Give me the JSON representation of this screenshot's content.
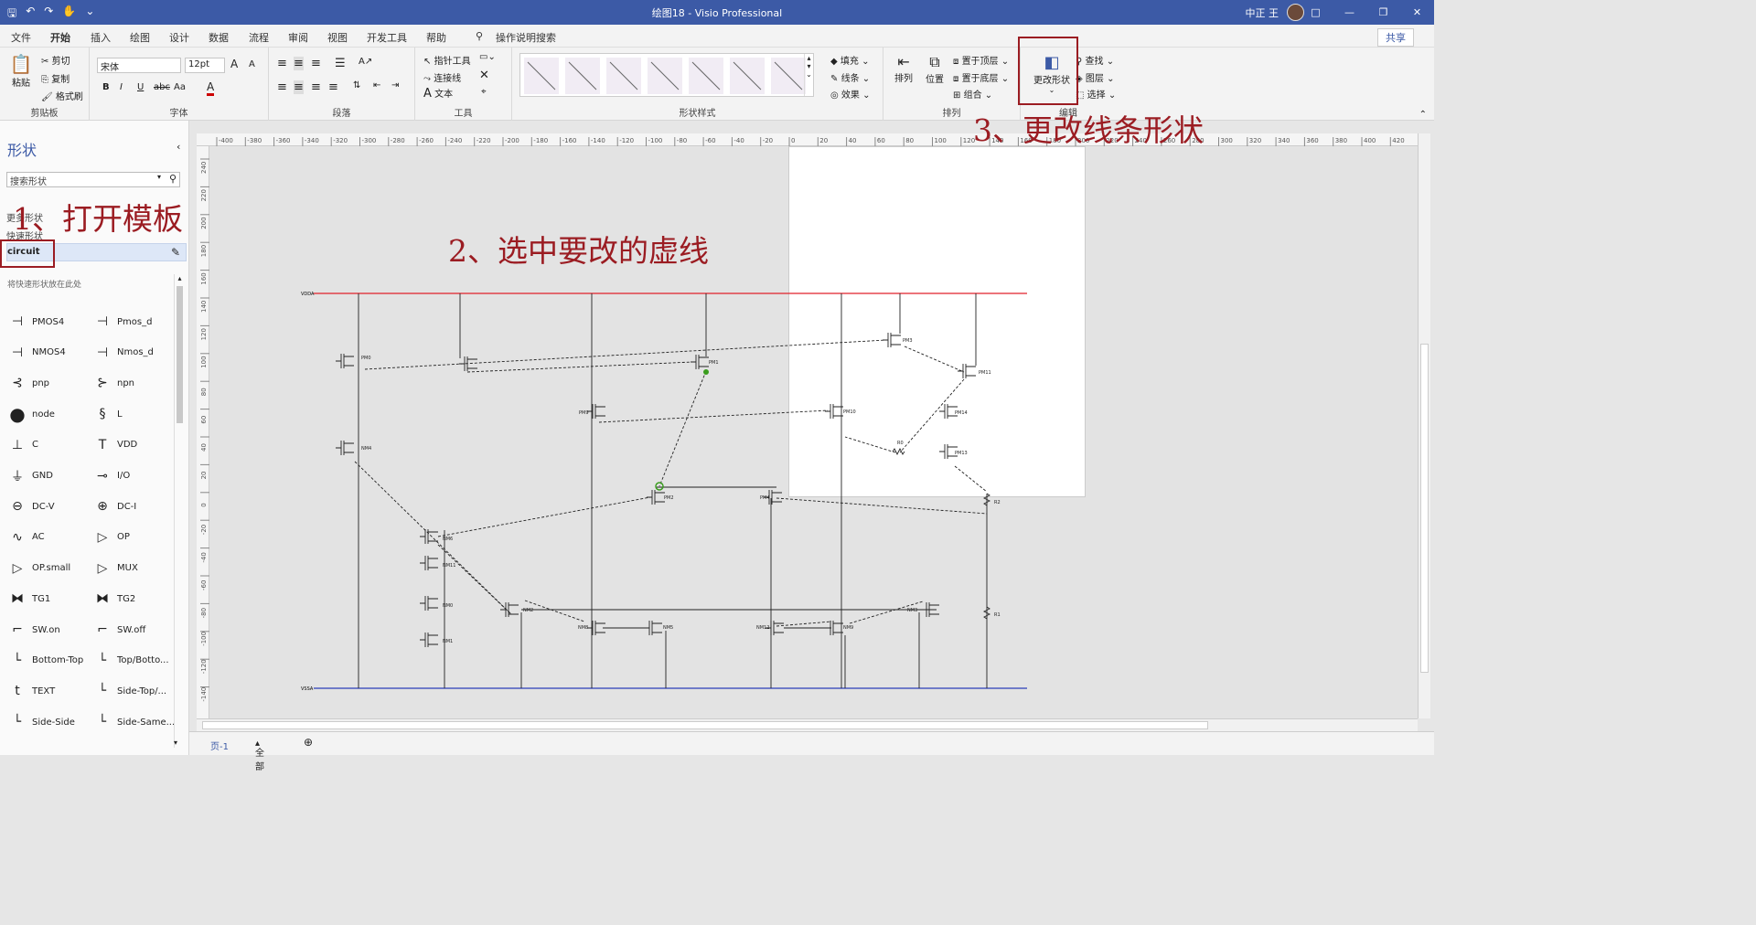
{
  "titlebar": {
    "title": "绘图18  -  Visio Professional",
    "user": "中正 王",
    "icons": [
      "save-icon",
      "undo-icon",
      "redo-icon",
      "touch-mode-icon",
      "customize-icon"
    ],
    "window_controls": [
      "□",
      "—",
      "❐",
      "✕"
    ]
  },
  "menubar": {
    "tabs": [
      "文件",
      "开始",
      "插入",
      "绘图",
      "设计",
      "数据",
      "流程",
      "审阅",
      "视图",
      "开发工具",
      "帮助"
    ],
    "active_tab": "开始",
    "tell_me": "操作说明搜索",
    "share": "共享"
  },
  "ribbon": {
    "clipboard": {
      "paste": "粘贴",
      "cut": "剪切",
      "copy": "复制",
      "format_painter": "格式刷",
      "label": "剪贴板"
    },
    "font": {
      "name": "宋体",
      "size": "12pt",
      "label": "字体",
      "bold": "B",
      "italic": "I",
      "underline": "U",
      "strike": "abc",
      "case": "Aa",
      "grow": "A",
      "shrink": "A"
    },
    "paragraph": {
      "label": "段落"
    },
    "tools": {
      "pointer": "指针工具",
      "connector": "连接线",
      "text": "文本",
      "label": "工具"
    },
    "shape_styles": {
      "label": "形状样式",
      "fill": "填充",
      "line": "线条",
      "effects": "效果"
    },
    "arrange": {
      "arrange": "排列",
      "position": "位置",
      "bring_front": "置于顶层",
      "send_back": "置于底层",
      "group": "组合",
      "label": "排列"
    },
    "edit": {
      "change_shape": "更改形状",
      "find": "查找",
      "layers": "图层",
      "select": "选择",
      "label": "编辑"
    }
  },
  "left_panel": {
    "title": "形状",
    "search_placeholder": "搜索形状",
    "more_shapes": "更多形状",
    "quick_shapes": "快速形状",
    "stencil": "circuit",
    "hint": "将快速形状放在此处",
    "shapes": [
      {
        "label": "PMOS4",
        "icon": "pmos-icon"
      },
      {
        "label": "Pmos_d",
        "icon": "pmos-icon"
      },
      {
        "label": "NMOS4",
        "icon": "nmos-icon"
      },
      {
        "label": "Nmos_d",
        "icon": "nmos-icon"
      },
      {
        "label": "pnp",
        "icon": "pnp-icon"
      },
      {
        "label": "npn",
        "icon": "npn-icon"
      },
      {
        "label": "node",
        "icon": "node-icon"
      },
      {
        "label": "L",
        "icon": "inductor-icon"
      },
      {
        "label": "C",
        "icon": "capacitor-icon"
      },
      {
        "label": "VDD",
        "icon": "vdd-icon"
      },
      {
        "label": "GND",
        "icon": "ground-icon"
      },
      {
        "label": "I/O",
        "icon": "io-icon"
      },
      {
        "label": "DC-V",
        "icon": "dcv-icon"
      },
      {
        "label": "DC-I",
        "icon": "dci-icon"
      },
      {
        "label": "AC",
        "icon": "ac-icon"
      },
      {
        "label": "OP",
        "icon": "opamp-icon"
      },
      {
        "label": "OP.small",
        "icon": "opamp-icon"
      },
      {
        "label": "MUX",
        "icon": "mux-icon"
      },
      {
        "label": "TG1",
        "icon": "tg-icon"
      },
      {
        "label": "TG2",
        "icon": "tg-icon"
      },
      {
        "label": "SW.on",
        "icon": "switch-icon"
      },
      {
        "label": "SW.off",
        "icon": "switch-icon"
      },
      {
        "label": "Bottom-Top",
        "icon": "connector-icon"
      },
      {
        "label": "Top/Botto...",
        "icon": "connector-icon"
      },
      {
        "label": "TEXT",
        "icon": "text-icon"
      },
      {
        "label": "Side-Top/...",
        "icon": "connector-icon"
      },
      {
        "label": "Side-Side",
        "icon": "connector-icon"
      },
      {
        "label": "Side-Same...",
        "icon": "connector-icon"
      }
    ]
  },
  "ruler": {
    "h_ticks": [
      "-400",
      "-380",
      "-360",
      "-340",
      "-320",
      "-300",
      "-280",
      "-260",
      "-240",
      "-220",
      "-200",
      "-180",
      "-160",
      "-140",
      "-120",
      "-100",
      "-80",
      "-60",
      "-40",
      "-20",
      "0",
      "20",
      "40",
      "60",
      "80",
      "100",
      "120",
      "140",
      "160",
      "180",
      "200",
      "220",
      "240",
      "260",
      "280",
      "300",
      "320",
      "340",
      "360",
      "380",
      "400",
      "420"
    ],
    "v_ticks": [
      "240",
      "220",
      "200",
      "180",
      "160",
      "140",
      "120",
      "100",
      "80",
      "60",
      "40",
      "20",
      "0",
      "-20",
      "-40",
      "-60",
      "-80",
      "-100",
      "-120",
      "-140"
    ]
  },
  "circuit": {
    "rail_top": "VDDA",
    "rail_bottom": "VSSA",
    "labels": [
      "PM0",
      "PM1",
      "PM3",
      "PM11",
      "PM9",
      "PM10",
      "PM14",
      "PM13",
      "NM4",
      "PM2",
      "PM4",
      "R2",
      "NM6",
      "NM11",
      "NM0",
      "NM1",
      "NM2",
      "NM8",
      "NM5",
      "NM12",
      "NM9",
      "NM3",
      "R1",
      "R0"
    ]
  },
  "annotations": {
    "step1": "1、打开模板",
    "step2": "2、选中要改的虚线",
    "step3": "3、更改线条形状"
  },
  "statusbar": {
    "page": "页-1",
    "all": "全部"
  },
  "colors": {
    "accent": "#3c5aa6",
    "annotation": "#9b1c22",
    "vdd_rail": "#e0202a",
    "vss_rail": "#2a3db8",
    "handle": "#3a9d1e"
  }
}
